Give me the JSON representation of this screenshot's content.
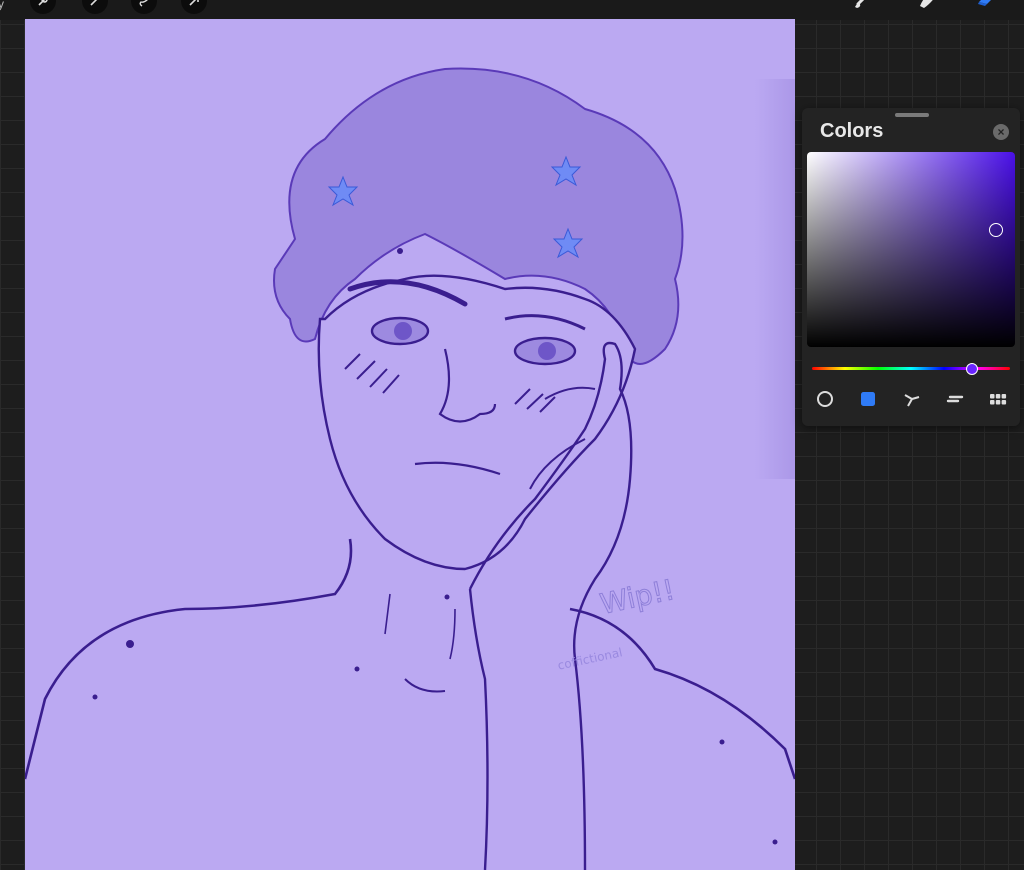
{
  "app": {
    "gallery_fragment": "y"
  },
  "toolbar": {
    "left_tools": [
      "wrench-icon",
      "magic-wand-icon",
      "selection-icon",
      "transform-arrow-icon"
    ],
    "right_tools": [
      "brush-icon",
      "smudge-icon",
      "eraser-icon"
    ],
    "active_tool": "eraser-icon",
    "accent_color": "#2f7bf6"
  },
  "canvas": {
    "background_color": "#bba9f2",
    "line_color": "#3a1e8f",
    "watermark_text": "Wip!!",
    "signature_text": "coffictional"
  },
  "colors_panel": {
    "title": "Colors",
    "current_color": "#4a10e8",
    "modes": [
      "disc-mode-icon",
      "classic-mode-icon",
      "harmony-mode-icon",
      "value-mode-icon",
      "palettes-mode-icon"
    ],
    "active_mode": "classic-mode-icon"
  }
}
